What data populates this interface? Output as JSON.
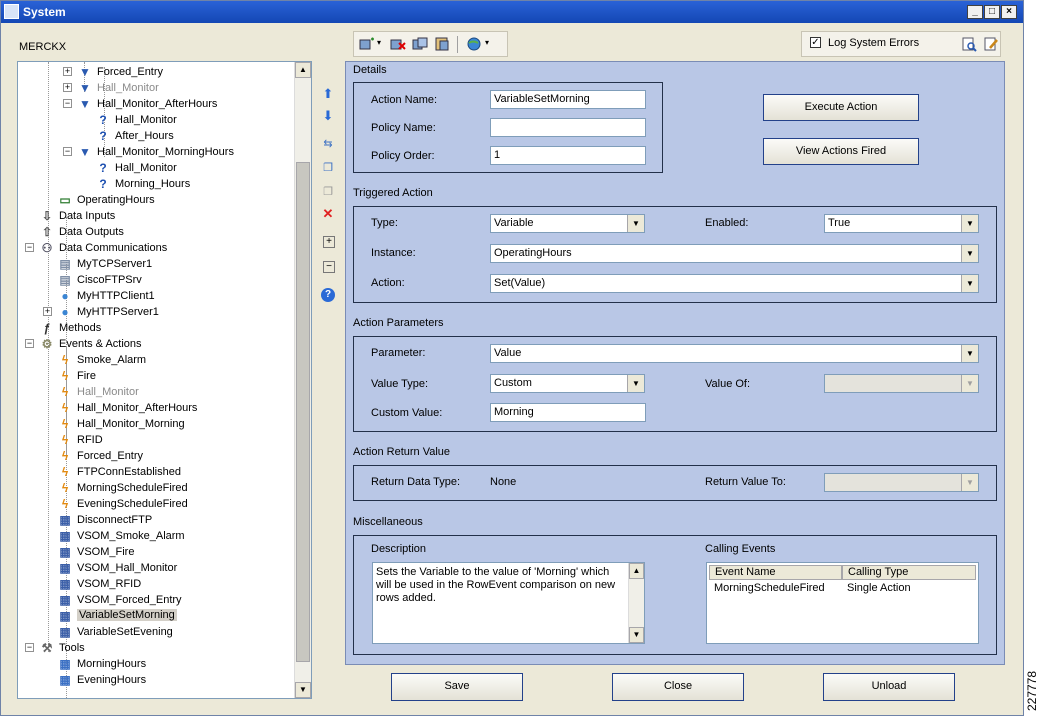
{
  "window": {
    "title": "System"
  },
  "site_name": "MERCKX",
  "toolbar": {
    "log_errors_label": "Log System Errors",
    "log_errors_checked": true
  },
  "tree": {
    "items": [
      {
        "label": "Forced_Entry",
        "icon": "filter-icon",
        "disabled": false
      },
      {
        "label": "Hall_Monitor",
        "icon": "filter-icon",
        "disabled": true
      },
      {
        "label": "Hall_Monitor_AfterHours",
        "icon": "filter-icon",
        "disabled": false
      },
      {
        "label": "Hall_Monitor",
        "icon": "question-icon",
        "disabled": false
      },
      {
        "label": "After_Hours",
        "icon": "question-icon",
        "disabled": false
      },
      {
        "label": "Hall_Monitor_MorningHours",
        "icon": "filter-icon",
        "disabled": false
      },
      {
        "label": "Hall_Monitor",
        "icon": "question-icon",
        "disabled": false
      },
      {
        "label": "Morning_Hours",
        "icon": "question-icon",
        "disabled": false
      },
      {
        "label": "OperatingHours",
        "icon": "variable-icon",
        "disabled": false
      },
      {
        "label": "Data Inputs",
        "icon": "data-inputs-icon",
        "disabled": false
      },
      {
        "label": "Data Outputs",
        "icon": "data-outputs-icon",
        "disabled": false
      },
      {
        "label": "Data Communications",
        "icon": "network-icon",
        "disabled": false
      },
      {
        "label": "MyTCPServer1",
        "icon": "server-icon",
        "disabled": false
      },
      {
        "label": "CiscoFTPSrv",
        "icon": "server-icon",
        "disabled": false
      },
      {
        "label": "MyHTTPClient1",
        "icon": "globe-icon",
        "disabled": false
      },
      {
        "label": "MyHTTPServer1",
        "icon": "globe-icon",
        "disabled": false
      },
      {
        "label": "Methods",
        "icon": "function-icon",
        "disabled": false
      },
      {
        "label": "Events & Actions",
        "icon": "events-icon",
        "disabled": false
      },
      {
        "label": "Smoke_Alarm",
        "icon": "lightning-icon",
        "disabled": false
      },
      {
        "label": "Fire",
        "icon": "lightning-icon",
        "disabled": false
      },
      {
        "label": "Hall_Monitor",
        "icon": "lightning-icon",
        "disabled": true
      },
      {
        "label": "Hall_Monitor_AfterHours",
        "icon": "lightning-icon",
        "disabled": false
      },
      {
        "label": "Hall_Monitor_Morning",
        "icon": "lightning-icon",
        "disabled": false
      },
      {
        "label": "RFID",
        "icon": "lightning-icon",
        "disabled": false
      },
      {
        "label": "Forced_Entry",
        "icon": "lightning-icon",
        "disabled": false
      },
      {
        "label": "FTPConnEstablished",
        "icon": "lightning-icon",
        "disabled": false
      },
      {
        "label": "MorningScheduleFired",
        "icon": "lightning-icon",
        "disabled": false
      },
      {
        "label": "EveningScheduleFired",
        "icon": "lightning-icon",
        "disabled": false
      },
      {
        "label": "DisconnectFTP",
        "icon": "action-icon",
        "disabled": false
      },
      {
        "label": "VSOM_Smoke_Alarm",
        "icon": "action-icon",
        "disabled": false
      },
      {
        "label": "VSOM_Fire",
        "icon": "action-icon",
        "disabled": false
      },
      {
        "label": "VSOM_Hall_Monitor",
        "icon": "action-icon",
        "disabled": false
      },
      {
        "label": "VSOM_RFID",
        "icon": "action-icon",
        "disabled": false
      },
      {
        "label": "VSOM_Forced_Entry",
        "icon": "action-icon",
        "disabled": false
      },
      {
        "label": "VariableSetMorning",
        "icon": "action-icon",
        "disabled": false
      },
      {
        "label": "VariableSetEvening",
        "icon": "action-icon",
        "disabled": false
      },
      {
        "label": "Tools",
        "icon": "tools-icon",
        "disabled": false
      },
      {
        "label": "MorningHours",
        "icon": "calendar-icon",
        "disabled": false
      },
      {
        "label": "EveningHours",
        "icon": "calendar-icon",
        "disabled": false
      }
    ]
  },
  "details": {
    "section": "Details",
    "action_name_label": "Action Name:",
    "action_name_value": "VariableSetMorning",
    "policy_name_label": "Policy Name:",
    "policy_name_value": "",
    "policy_order_label": "Policy Order:",
    "policy_order_value": "1",
    "execute_button": "Execute Action",
    "view_fired_button": "View Actions Fired"
  },
  "triggered": {
    "section": "Triggered Action",
    "type_label": "Type:",
    "type_value": "Variable",
    "enabled_label": "Enabled:",
    "enabled_value": "True",
    "instance_label": "Instance:",
    "instance_value": "OperatingHours",
    "action_label": "Action:",
    "action_value": "Set(Value)"
  },
  "params": {
    "section": "Action Parameters",
    "parameter_label": "Parameter:",
    "parameter_value": "Value",
    "value_type_label": "Value Type:",
    "value_type_value": "Custom",
    "value_of_label": "Value Of:",
    "value_of_value": "",
    "custom_value_label": "Custom Value:",
    "custom_value_value": "Morning"
  },
  "return": {
    "section": "Action Return Value",
    "data_type_label": "Return Data Type:",
    "data_type_value": "None",
    "return_to_label": "Return Value To:",
    "return_to_value": ""
  },
  "misc": {
    "section": "Miscellaneous",
    "description_label": "Description",
    "description_text": "Sets the Variable to the value of 'Morning' which will be used in the RowEvent comparison on new rows added.",
    "calling_events_label": "Calling Events",
    "columns": [
      "Event Name",
      "Calling Type"
    ],
    "rows": [
      [
        "MorningScheduleFired",
        "Single Action"
      ]
    ]
  },
  "buttons": {
    "save": "Save",
    "close": "Close",
    "unload": "Unload"
  },
  "side_code": "227778",
  "colors": {
    "panel": "#b9c7e6",
    "titlebar": "#1f55c6"
  }
}
